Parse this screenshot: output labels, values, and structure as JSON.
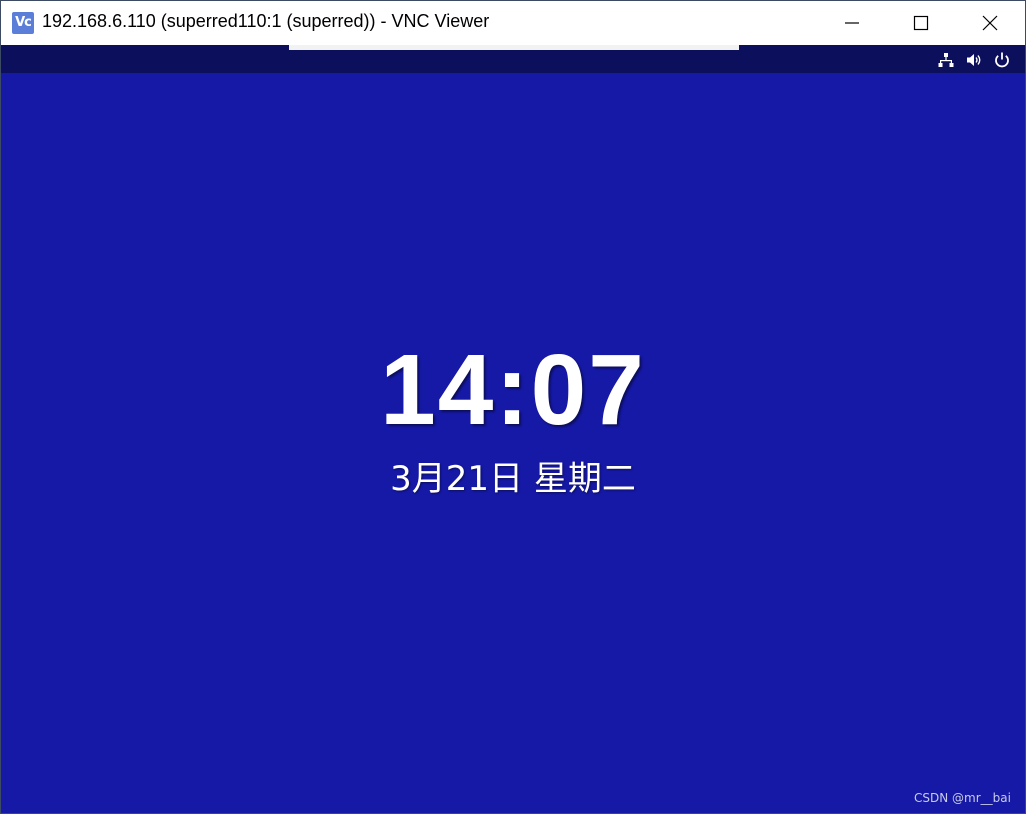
{
  "window": {
    "app_icon_text": "Vc",
    "title": "192.168.6.110 (superred110:1 (superred)) - VNC Viewer"
  },
  "tray": {
    "icons": [
      "network-icon",
      "volume-icon",
      "power-icon"
    ]
  },
  "lock_screen": {
    "time": "14:07",
    "date": "3月21日 星期二"
  },
  "watermark": "CSDN @mr__bai",
  "colors": {
    "desktop": "#1619a6",
    "topbar": "#0b0f5c",
    "app_icon": "#5b7fd8"
  }
}
